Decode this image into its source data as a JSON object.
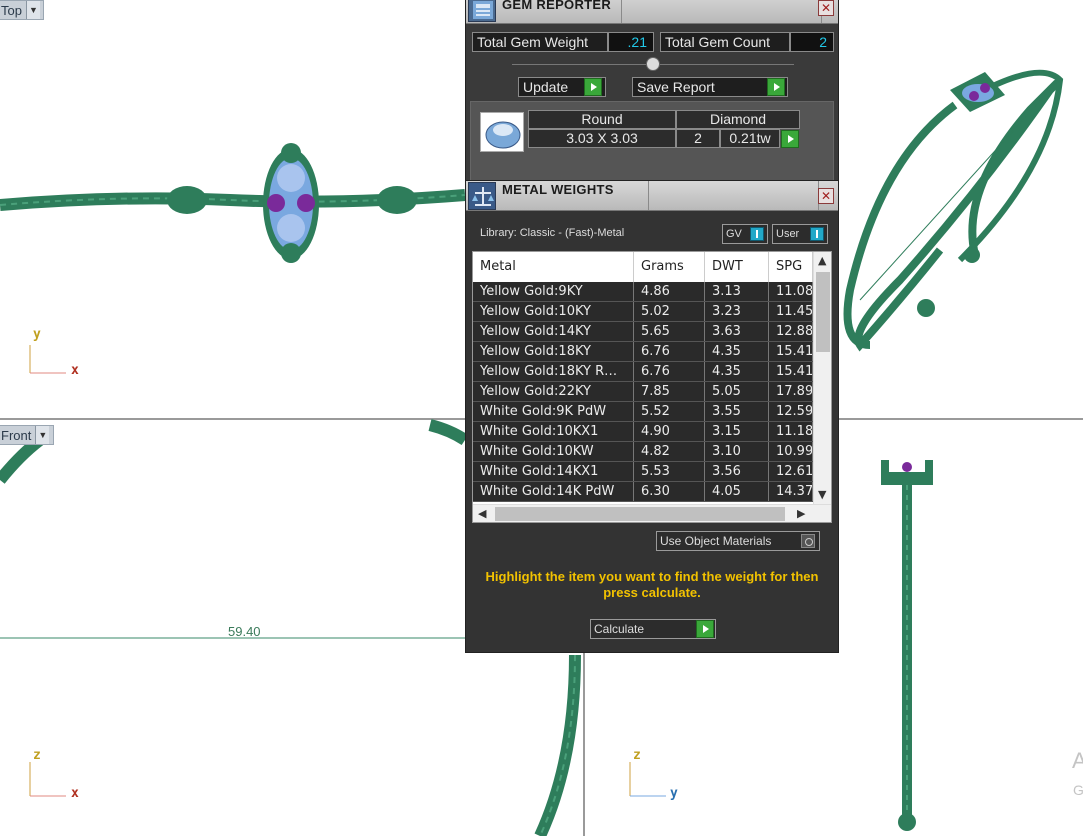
{
  "viewports": {
    "top": {
      "label": "Top",
      "axis_v": "y",
      "axis_h": "x"
    },
    "front": {
      "label": "Front",
      "axis_v": "z",
      "axis_h": "x",
      "dimension": "59.40"
    },
    "right": {
      "axis_v": "z",
      "axis_h": "y"
    }
  },
  "gem_reporter": {
    "title": "GEM REPORTER",
    "total_weight_label": "Total Gem Weight",
    "total_weight_value": ".21",
    "total_count_label": "Total Gem Count",
    "total_count_value": "2",
    "update_label": "Update",
    "save_label": "Save Report",
    "gem": {
      "shape": "Round",
      "type": "Diamond",
      "size": "3.03 X 3.03",
      "count": "2",
      "weight": "0.21tw"
    }
  },
  "metal_weights": {
    "title": "METAL WEIGHTS",
    "library": "Library: Classic - (Fast)-Metal",
    "gv_label": "GV",
    "user_label": "User",
    "columns": [
      "Metal",
      "Grams",
      "DWT",
      "SPG"
    ],
    "rows": [
      [
        "Yellow Gold:9KY",
        "4.86",
        "3.13",
        "11.08"
      ],
      [
        "Yellow Gold:10KY",
        "5.02",
        "3.23",
        "11.45"
      ],
      [
        "Yellow Gold:14KY",
        "5.65",
        "3.63",
        "12.88"
      ],
      [
        "Yellow Gold:18KY",
        "6.76",
        "4.35",
        "15.41"
      ],
      [
        "Yellow Gold:18KY R…",
        "6.76",
        "4.35",
        "15.41"
      ],
      [
        "Yellow Gold:22KY",
        "7.85",
        "5.05",
        "17.89"
      ],
      [
        "White Gold:9K PdW",
        "5.52",
        "3.55",
        "12.59"
      ],
      [
        "White Gold:10KX1",
        "4.90",
        "3.15",
        "11.18"
      ],
      [
        "White Gold:10KW",
        "4.82",
        "3.10",
        "10.99"
      ],
      [
        "White Gold:14KX1",
        "5.53",
        "3.56",
        "12.61"
      ],
      [
        "White Gold:14K PdW",
        "6.30",
        "4.05",
        "14.37"
      ]
    ],
    "use_object_materials": "Use Object Materials",
    "hint": "Highlight the item you want to find the weight for then press calculate.",
    "calculate_label": "Calculate"
  },
  "colors": {
    "ring_green": "#2e7d5b",
    "gem_blue": "#7aa8e0",
    "gem_purple": "#7a2a9a",
    "accent_cyan": "#22c8e8",
    "hint_yellow": "#f2c200"
  },
  "watermark": {
    "line1": "A",
    "line2": "G"
  }
}
